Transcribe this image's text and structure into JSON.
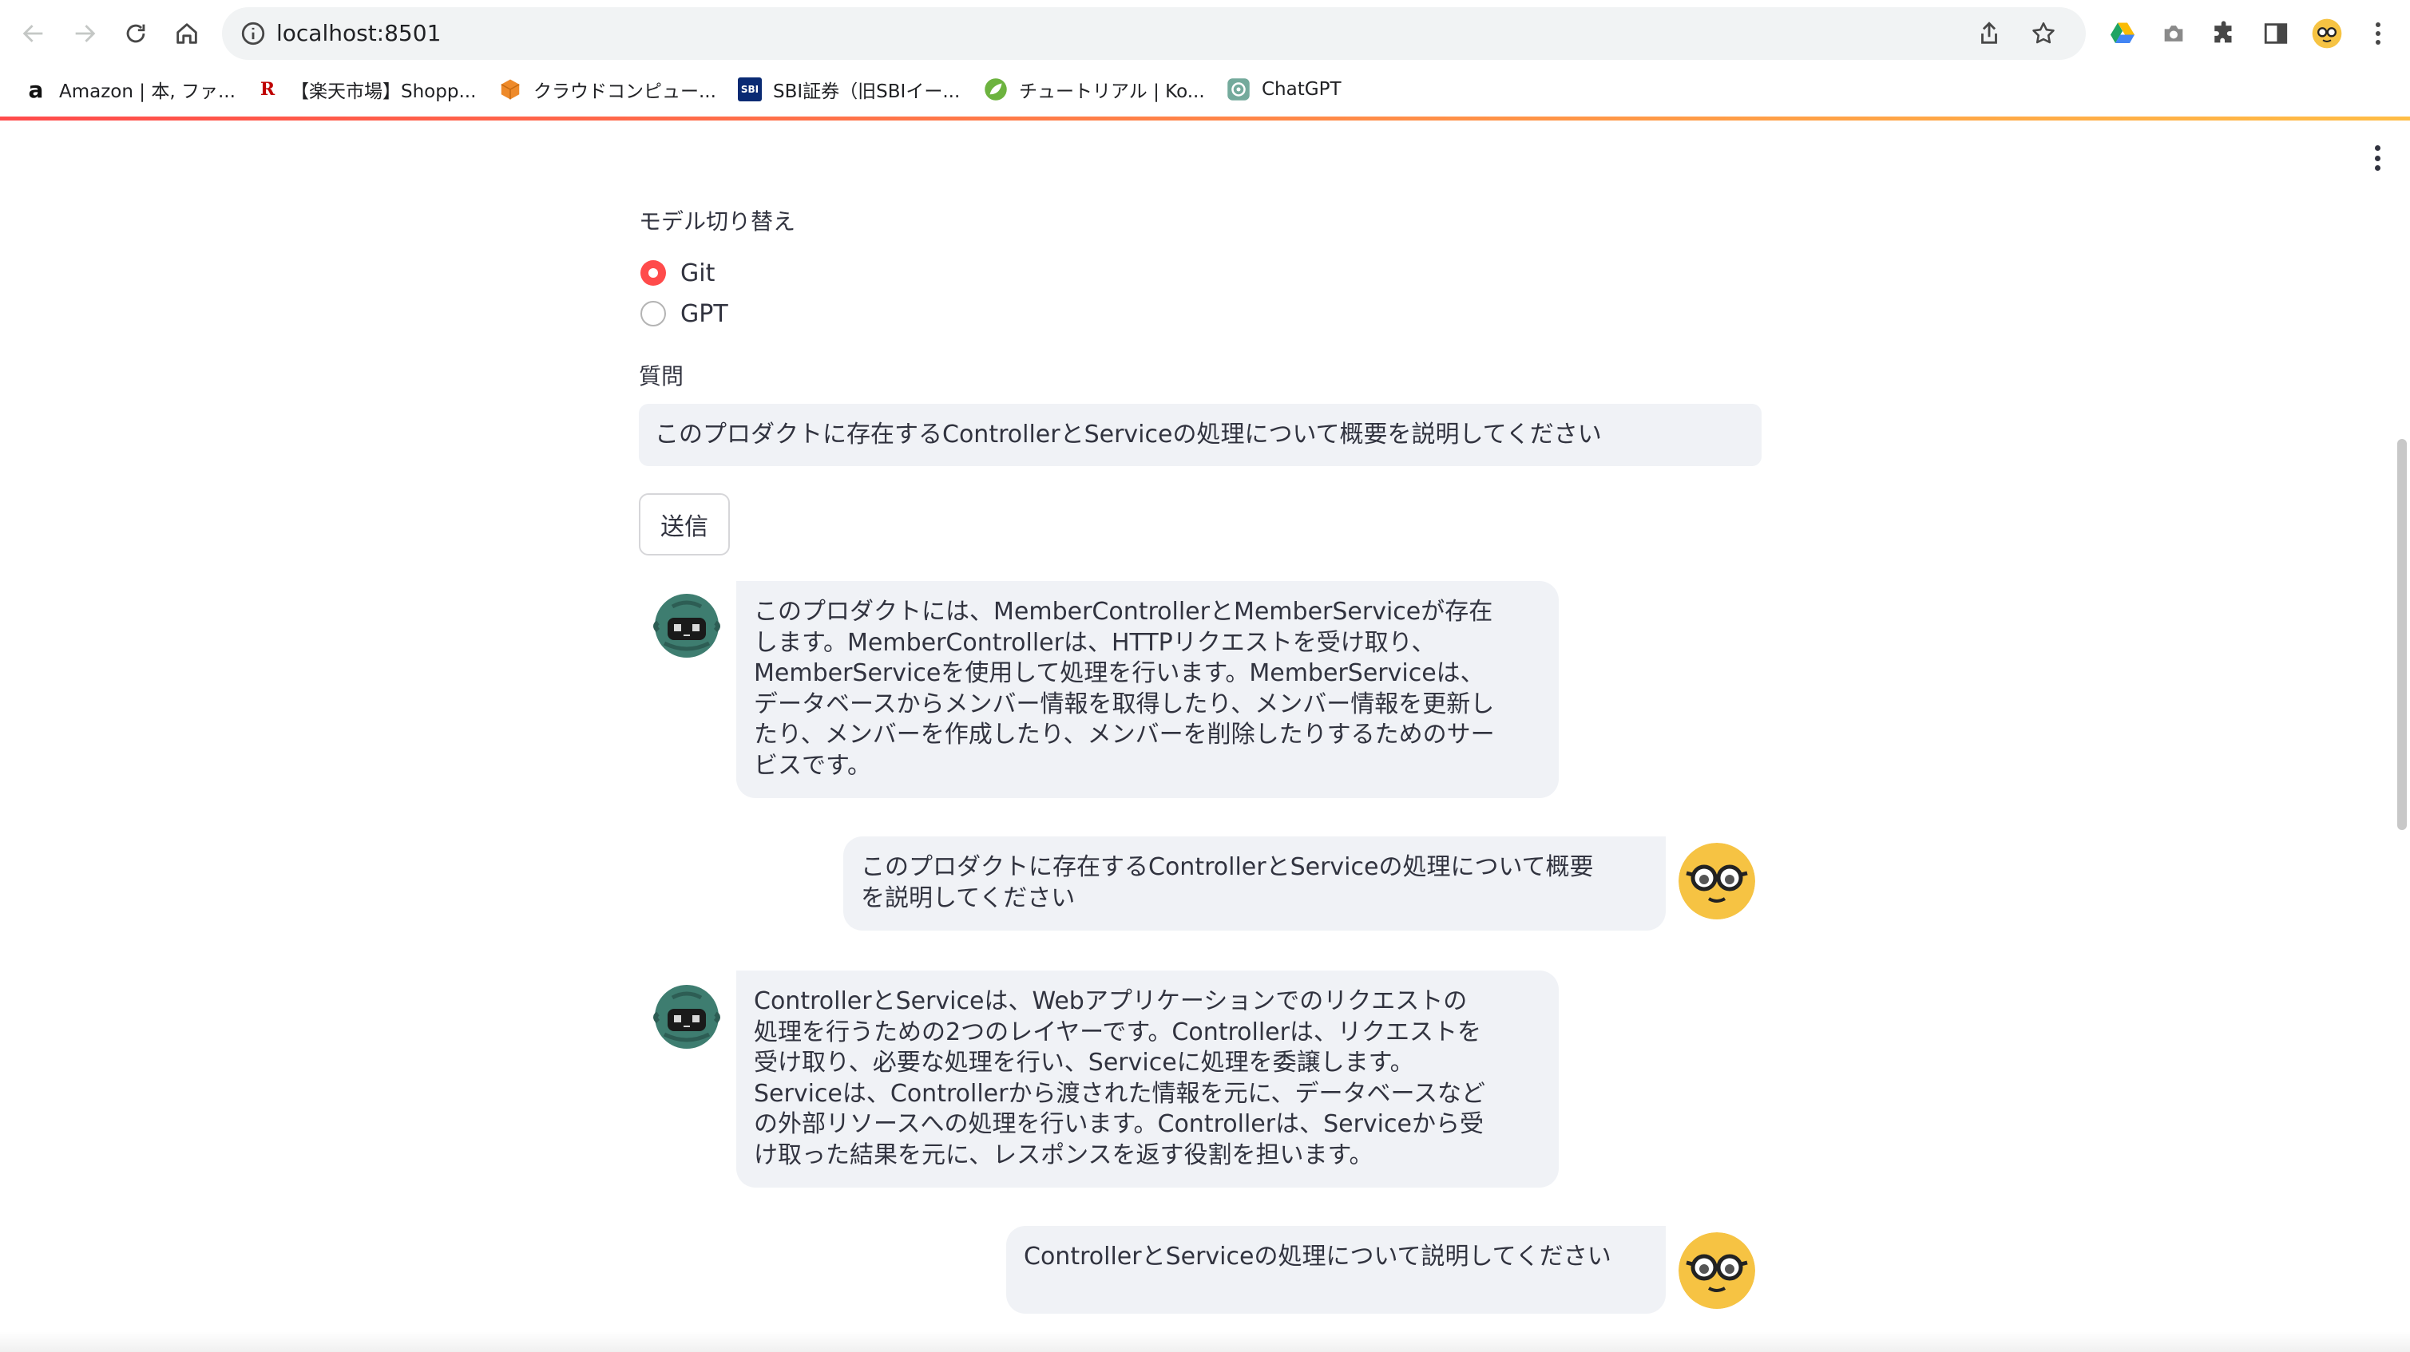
{
  "browser": {
    "url": "localhost:8501",
    "bookmarks": [
      {
        "label": "Amazon | 本, ファ...",
        "icon": "amazon-icon"
      },
      {
        "label": "【楽天市場】Shopp...",
        "icon": "rakuten-icon"
      },
      {
        "label": "クラウドコンピュー...",
        "icon": "cloud-box-icon"
      },
      {
        "label": "SBI証券（旧SBIイー...",
        "icon": "sbi-icon"
      },
      {
        "label": "チュートリアル | Ko...",
        "icon": "leaf-icon"
      },
      {
        "label": "ChatGPT",
        "icon": "chatgpt-icon"
      }
    ]
  },
  "app": {
    "model_label": "モデル切り替え",
    "model_options": [
      {
        "label": "Git",
        "selected": true
      },
      {
        "label": "GPT",
        "selected": false
      }
    ],
    "question_label": "質問",
    "question_value": "このプロダクトに存在するControllerとServiceの処理について概要を説明してください",
    "send_label": "送信",
    "accent_color": "#ff4b4b"
  },
  "chat": [
    {
      "role": "bot",
      "avatar": "robot-avatar",
      "lines": [
        "このプロダクトには、MemberControllerとMemberServiceが存在",
        "します。MemberControllerは、HTTPリクエストを受け取り、",
        "MemberServiceを使用して処理を行います。MemberServiceは、",
        "データベースからメンバー情報を取得したり、メンバー情報を更新し",
        "たり、メンバーを作成したり、メンバーを削除したりするためのサー",
        "ビスです。"
      ]
    },
    {
      "role": "user",
      "avatar": "glasses-face-avatar",
      "lines": [
        "このプロダクトに存在するControllerとServiceの処理について概要",
        "を説明してください"
      ]
    },
    {
      "role": "bot",
      "avatar": "robot-avatar",
      "lines": [
        "ControllerとServiceは、Webアプリケーションでのリクエストの",
        "処理を行うための2つのレイヤーです。Controllerは、リクエストを",
        "受け取り、必要な処理を行い、Serviceに処理を委譲します。",
        "Serviceは、Controllerから渡された情報を元に、データベースなど",
        "の外部リソースへの処理を行います。Controllerは、Serviceから受",
        "け取った結果を元に、レスポンスを返す役割を担います。"
      ]
    },
    {
      "role": "user",
      "avatar": "glasses-face-avatar",
      "lines": [
        "ControllerとServiceの処理について説明してください"
      ]
    }
  ]
}
